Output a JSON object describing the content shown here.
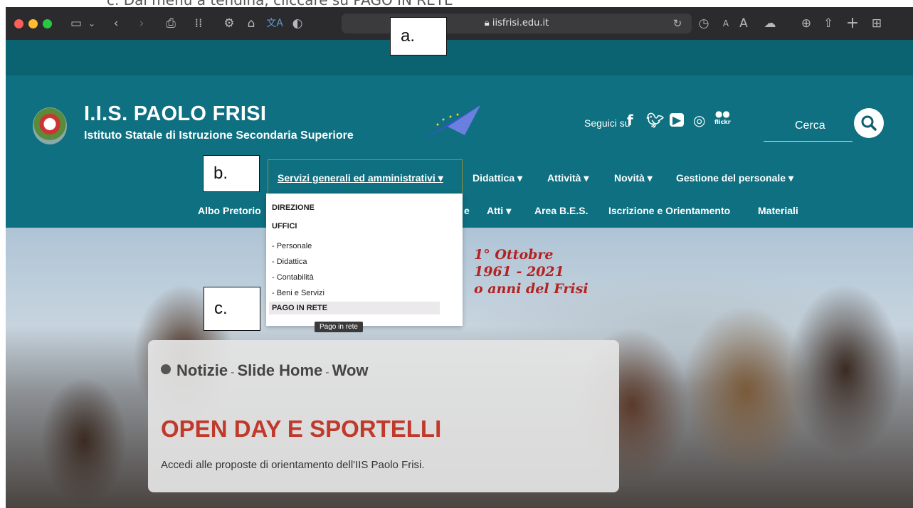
{
  "doc": {
    "caption": "c.  Dal menu a tendina, cliccare su PAGO IN RETE"
  },
  "browser": {
    "url": "iisfrisi.edu.it",
    "icons": [
      "sidebar-icon",
      "chevron-down-icon",
      "back-icon",
      "forward-icon",
      "printer-icon",
      "grid-icon",
      "gear-icon",
      "home-icon",
      "translate-icon",
      "shield-icon",
      "lock-icon",
      "reload-icon",
      "history-icon",
      "font-small-icon",
      "font-large-icon",
      "cloud-icon",
      "download-icon",
      "share-icon",
      "new-tab-icon",
      "tab-overview-icon"
    ]
  },
  "site": {
    "title": "I.I.S. PAOLO FRISI",
    "subtitle": "Istituto Statale di Istruzione Secondaria Superiore",
    "follow_label": "Seguici su",
    "social": [
      "facebook-icon",
      "twitter-icon",
      "youtube-icon",
      "instagram-icon",
      "flickr-icon"
    ],
    "flickr_label": "flickr",
    "search_label": "Cerca",
    "nav": {
      "main": [
        "Servizi generali ed amministrativi ▾",
        "Didattica ▾",
        "Attività ▾",
        "Novità ▾",
        "Gestione del personale ▾"
      ],
      "secondary": [
        "Albo Pretorio",
        "e",
        "Atti ▾",
        "Area B.E.S.",
        "Iscrizione e Orientamento",
        "Materiali"
      ]
    },
    "dropdown": {
      "items": [
        {
          "label": "DIREZIONE",
          "header": true
        },
        {
          "label": "UFFICI",
          "header": true
        },
        {
          "label": "- Personale",
          "header": false
        },
        {
          "label": "- Didattica",
          "header": false
        },
        {
          "label": "- Contabilità",
          "header": false
        },
        {
          "label": "- Beni e Servizi",
          "header": false
        },
        {
          "label": "PAGO IN RETE",
          "header": true
        }
      ],
      "tooltip": "Pago in rete"
    },
    "hero": {
      "anniversary_line1": "1° Ottobre",
      "anniversary_line2": "1961 - 2021",
      "anniversary_line3": "o anni del Frisi",
      "card": {
        "crumbs": [
          "Notizie",
          "Slide Home",
          "Wow"
        ],
        "separator": "-",
        "title": "OPEN DAY E SPORTELLI",
        "description": "Accedi alle proposte di orientamento dell'IIS Paolo Frisi."
      }
    }
  },
  "annotations": [
    "a.",
    "b.",
    "c."
  ],
  "colors": {
    "site_teal": "#0e7081",
    "toolbar": "#2b2b2d",
    "card_title": "#c0392b"
  }
}
